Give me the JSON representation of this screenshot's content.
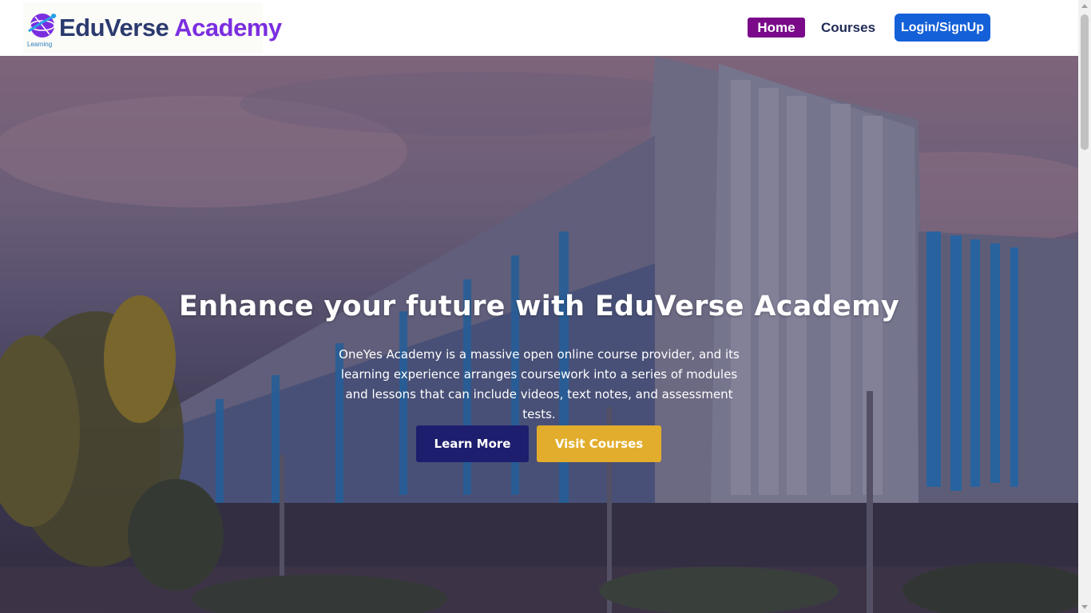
{
  "navbar": {
    "logo": {
      "brand_first": "EduVerse",
      "brand_second": "Academy",
      "tagline": "Learning",
      "icon": "globe-logo-icon"
    },
    "links": {
      "home": "Home",
      "courses": "Courses",
      "login": "Login/SignUp"
    }
  },
  "hero": {
    "title": "Enhance your future with EduVerse Academy",
    "description": "OneYes Academy is a massive open online course provider, and its learning experience arranges coursework into a series of modules and lessons that can include videos, text notes, and assessment tests.",
    "buttons": {
      "learn_more": "Learn More",
      "visit_courses": "Visit Courses"
    },
    "background": "campus-building-photo"
  },
  "colors": {
    "home_active": "#7a0a8a",
    "login_button": "#1460d8",
    "learn_more_button": "#1e1e6e",
    "visit_courses_button": "#e2ad2c",
    "brand_primary": "#2b3a6e",
    "brand_accent": "#7b2ee0"
  }
}
